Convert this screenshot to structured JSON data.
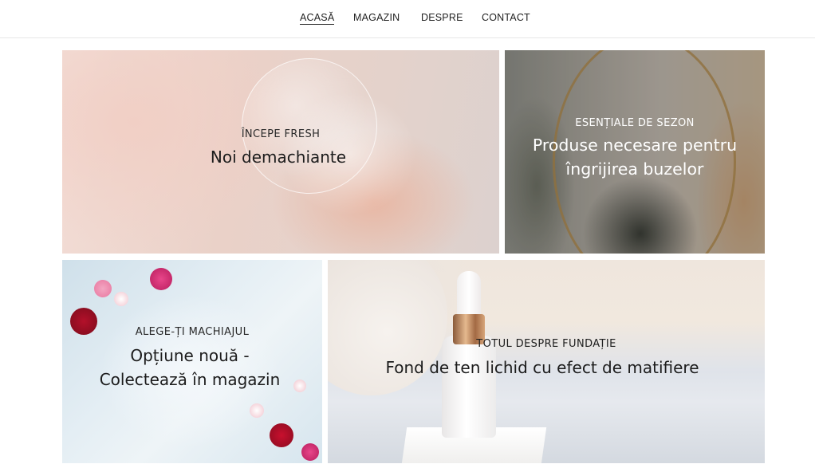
{
  "nav": {
    "items": [
      {
        "label": "ACASĂ",
        "active": true
      },
      {
        "label": "MAGAZIN",
        "active": false
      },
      {
        "label": "DESPRE",
        "active": false
      },
      {
        "label": "CONTACT",
        "active": false
      }
    ]
  },
  "tiles": [
    {
      "kicker": "ÎNCEPE FRESH",
      "headline": "Noi demachiante"
    },
    {
      "kicker": "ESENȚIALE DE SEZON",
      "headline_line1": "Produse necesare pentru",
      "headline_line2": "îngrijirea buzelor"
    },
    {
      "kicker": "ALEGE-ȚI MACHIAJUL",
      "headline_line1": "Opțiune nouă -",
      "headline_line2": "Colectează în magazin"
    },
    {
      "kicker": "TOTUL DESPRE FUNDAȚIE",
      "headline": "Fond de ten lichid cu efect de matifiere"
    }
  ],
  "colors": {
    "text_dark": "#1c1c1c",
    "text_light": "#ffffff",
    "nav_border": "#e6e6e6"
  }
}
